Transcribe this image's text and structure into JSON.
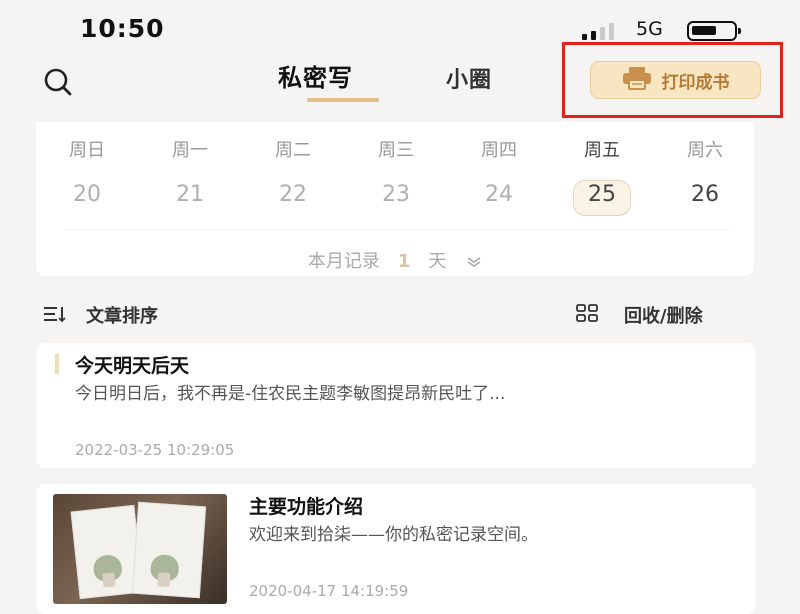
{
  "status_bar": {
    "time": "10:50",
    "network": "5G"
  },
  "header": {
    "tab_active": "私密写",
    "tab_other": "小圈",
    "print_button": "打印成书"
  },
  "calendar": {
    "weekdays": [
      "周日",
      "周一",
      "周二",
      "周三",
      "周四",
      "周五",
      "周六"
    ],
    "dates": [
      "20",
      "21",
      "22",
      "23",
      "24",
      "25",
      "26"
    ],
    "selected_index": 5,
    "record_prefix": "本月记录",
    "record_count": "1",
    "record_suffix": "天"
  },
  "toolbar": {
    "sort_label": "文章排序",
    "recycle_label": "回收/删除"
  },
  "entries": [
    {
      "title": "今天明天后天",
      "body": "今日明日后，我不再是-住农民主题李敏图提昂新民吐了...",
      "time": "2022-03-25 10:29:05"
    },
    {
      "title": "主要功能介绍",
      "body": "欢迎来到拾柒——你的私密记录空间。",
      "time": "2020-04-17 14:19:59"
    }
  ],
  "colors": {
    "accent": "#e3c289",
    "print_button_bg": "#f8e5c1",
    "print_button_text": "#b57a33",
    "highlight_box": "#e2231a"
  }
}
